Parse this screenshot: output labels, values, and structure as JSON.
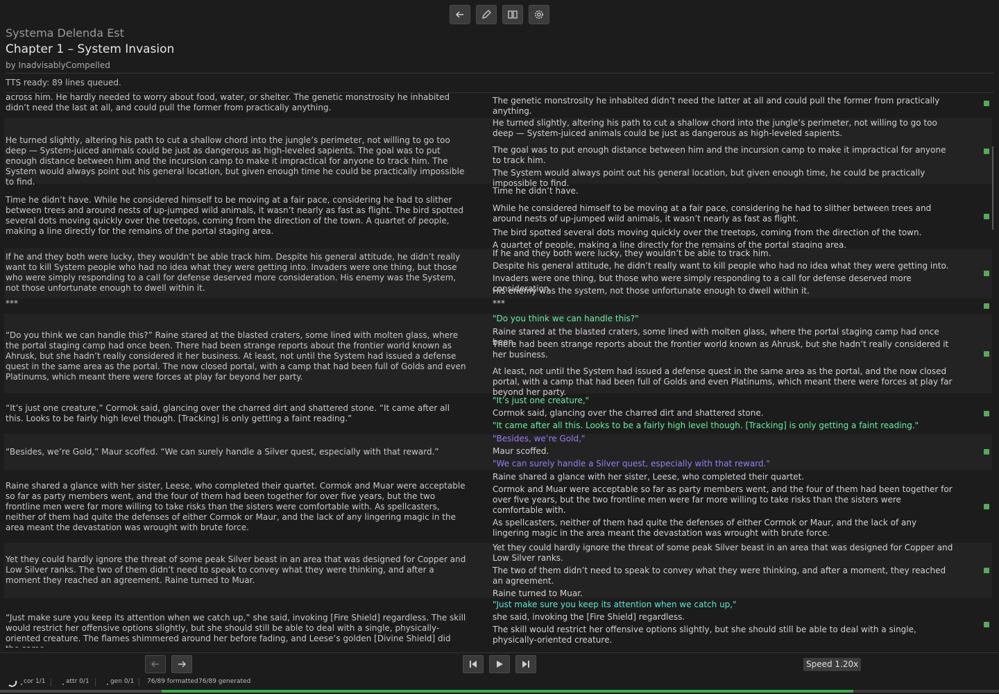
{
  "header": {
    "series": "Systema Delenda Est",
    "chapter": "Chapter 1 – System Invasion",
    "author": "by InadvisablyCompelled",
    "tts_status": "TTS ready: 89 lines queued."
  },
  "toolbar": {
    "icons": [
      "back-arrow-icon",
      "pencil-icon",
      "book-icon",
      "gear-icon"
    ]
  },
  "paragraphs": [
    {
      "source": "across him. He hardly needed to worry about food, water, or shelter. The genetic monstrosity he inhabited didn’t need the last at all, and could pull the former from practically anything.",
      "lines": [
        {
          "text": "The genetic monstrosity he inhabited didn’t need the latter at all and could pull the former from practically anything.",
          "tone": "normal"
        }
      ]
    },
    {
      "source": "He turned slightly, altering his path to cut a shallow chord into the jungle’s perimeter, not willing to go too deep — System-juiced animals could be just as dangerous as high-leveled sapients. The goal was to put enough distance between him and the incursion camp to make it impractical for anyone to track him. The System would always point out his general location, but given enough time he could be practically impossible to find.",
      "lines": [
        {
          "text": "He turned slightly, altering his path to cut a shallow chord into the jungle’s perimeter, not willing to go too deep — System-juiced animals could be just as dangerous as high-leveled sapients.",
          "tone": "normal"
        },
        {
          "text": "The goal was to put enough distance between him and the incursion camp to make it impractical for anyone to track him.",
          "tone": "normal"
        },
        {
          "text": "The System would always point out his general location, but given enough time, he could be practically impossible to find.",
          "tone": "normal"
        }
      ]
    },
    {
      "source": "Time he didn’t have. While he considered himself to be moving at a fair pace, considering he had to slither between trees and around nests of up-jumped wild animals, it wasn’t nearly as fast as flight. The bird spotted several dots moving quickly over the treetops, coming from the direction of the town. A quartet of people, making a line directly for the remains of the portal staging area.",
      "lines": [
        {
          "text": "Time he didn’t have.",
          "tone": "normal"
        },
        {
          "text": "While he considered himself to be moving at a fair pace, considering he had to slither between trees and around nests of up-jumped wild animals, it wasn’t nearly as fast as flight.",
          "tone": "normal"
        },
        {
          "text": "The bird spotted several dots moving quickly over the treetops, coming from the direction of the town.",
          "tone": "normal"
        },
        {
          "text": "A quartet of people, making a line directly for the remains of the portal staging area.",
          "tone": "normal"
        }
      ]
    },
    {
      "source": "If he and they both were lucky, they wouldn’t be able track him. Despite his general attitude, he didn’t really want to kill System people who had no idea what they were getting into. Invaders were one thing, but those who were simply responding to a call for defense deserved more consideration. His enemy was the System, not those unfortunate enough to dwell within it.",
      "lines": [
        {
          "text": "If he and they both were lucky, they wouldn’t be able to track him.",
          "tone": "normal"
        },
        {
          "text": "Despite his general attitude, he didn’t really want to kill people who had no idea what they were getting into.",
          "tone": "normal"
        },
        {
          "text": "Invaders were one thing, but those who were simply responding to a call for defense deserved more consideration.",
          "tone": "normal"
        },
        {
          "text": "His enemy was the system, not those unfortunate enough to dwell within it.",
          "tone": "normal"
        }
      ]
    },
    {
      "source": "***",
      "lines": [
        {
          "text": "***",
          "tone": "normal"
        }
      ]
    },
    {
      "source": "“Do you think we can handle this?” Raine stared at the blasted craters, some lined with molten glass, where the portal staging camp had once been. There had been strange reports about the frontier world known as Ahrusk, but she hadn’t really considered it her business. At least, not until the System had issued a defense quest in the same area as the portal. The now closed portal, with a camp that had been full of Golds and even Platinums, which meant there were forces at play far beyond her party.",
      "lines": [
        {
          "text": "\"Do you think we can handle this?\"",
          "tone": "green"
        },
        {
          "text": "Raine stared at the blasted craters, some lined with molten glass, where the portal staging camp had once been.",
          "tone": "normal"
        },
        {
          "text": "There had been strange reports about the frontier world known as Ahrusk, but she hadn’t really considered it her business.",
          "tone": "normal"
        },
        {
          "text": "At least, not until the System had issued a defense quest in the same area as the portal, and the now closed portal, with a camp that had been full of Golds and even Platinums, which meant there were forces at play far beyond her party.",
          "tone": "normal"
        }
      ]
    },
    {
      "source": "“It’s just one creature,” Cormok said, glancing over the charred dirt and shattered stone. “It came after all this. Looks to be fairly high level though. [Tracking] is only getting a faint reading.”",
      "lines": [
        {
          "text": "\"It’s just one creature,\"",
          "tone": "green"
        },
        {
          "text": "Cormok said, glancing over the charred dirt and shattered stone.",
          "tone": "normal"
        },
        {
          "text": "\"It came after all this. Looks to be a fairly high level though. [Tracking] is only getting a faint reading.\"",
          "tone": "green"
        }
      ]
    },
    {
      "source": "“Besides, we’re Gold,” Maur scoffed. “We can surely handle a Silver quest, especially with that reward.”",
      "lines": [
        {
          "text": "\"Besides, we’re Gold,\"",
          "tone": "purple"
        },
        {
          "text": "Maur scoffed.",
          "tone": "normal"
        },
        {
          "text": "\"We can surely handle a Silver quest, especially with that reward.\"",
          "tone": "purple"
        }
      ]
    },
    {
      "source": "Raine shared a glance with her sister, Leese, who completed their quartet. Cormok and Muar were acceptable so far as party members went, and the four of them had been together for over five years, but the two frontline men were far more willing to take risks than the sisters were comfortable with. As spellcasters, neither of them had quite the defenses of either Cormok or Maur, and the lack of any lingering magic in the area meant the devastation was wrought with brute force.",
      "lines": [
        {
          "text": "Raine shared a glance with her sister, Leese, who completed their quartet.",
          "tone": "normal"
        },
        {
          "text": "Cormok and Muar were acceptable so far as party members went, and the four of them had been together for over five years, but the two frontline men were far more willing to take risks than the sisters were comfortable with.",
          "tone": "normal"
        },
        {
          "text": "As spellcasters, neither of them had quite the defenses of either Cormok or Maur, and the lack of any lingering magic in the area meant the devastation was wrought with brute force.",
          "tone": "normal"
        }
      ]
    },
    {
      "source": "Yet they could hardly ignore the threat of some peak Silver beast in an area that was designed for Copper and Low Silver ranks. The two of them didn’t need to speak to convey what they were thinking, and after a moment they reached an agreement. Raine turned to Muar.",
      "lines": [
        {
          "text": "Yet they could hardly ignore the threat of some peak Silver beast in an area that was designed for Copper and Low Silver ranks.",
          "tone": "normal"
        },
        {
          "text": "The two of them didn’t need to speak to convey what they were thinking, and after a moment, they reached an agreement.",
          "tone": "normal"
        },
        {
          "text": "Raine turned to Muar.",
          "tone": "normal"
        }
      ]
    },
    {
      "source": "“Just make sure you keep its attention when we catch up,” she said, invoking [Fire Shield] regardless. The skill would restrict her offensive options slightly, but she should still be able to deal with a single, physically-oriented creature. The flames shimmered around her before fading, and Leese’s golden [Divine Shield] did the same.",
      "lines": [
        {
          "text": "\"Just make sure you keep its attention when we catch up,\"",
          "tone": "cyan"
        },
        {
          "text": "she said, invoking the [Fire Shield] regardless.",
          "tone": "normal"
        },
        {
          "text": "The skill would restrict her offensive options slightly, but she should still be able to deal with a single, physically-oriented creature.",
          "tone": "normal"
        }
      ]
    }
  ],
  "playback": {
    "icons": [
      "prev-arrow-icon",
      "next-arrow-icon",
      "skip-back-icon",
      "play-icon",
      "skip-forward-icon"
    ],
    "speed_label": "Speed 1.20x"
  },
  "status": {
    "cor": "cor 1/1",
    "attr": "attr 0/1",
    "gen": "gen 0/1",
    "formatted": "76/89 formatted",
    "generated": "76/89 generated"
  },
  "progress": {
    "formatted_fraction": 0.854,
    "generated_fraction": 0.162
  },
  "colors": {
    "speech_green": "#6cec9f",
    "speech_cyan": "#5fe6d3",
    "speech_purple": "#9a7cf2",
    "progress": "#3aae4e"
  }
}
